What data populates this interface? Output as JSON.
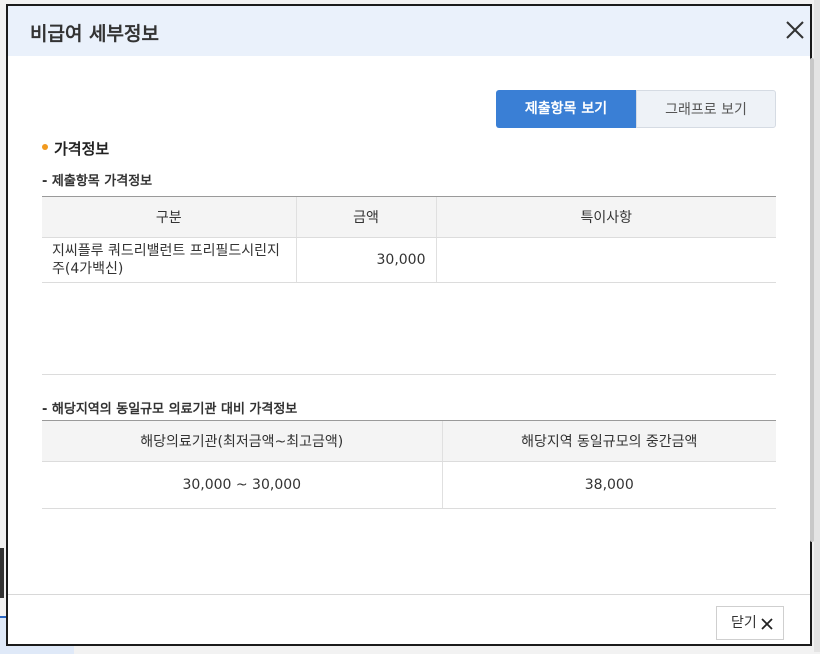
{
  "dialog": {
    "title": "비급여 세부정보",
    "close_icon": "close-icon"
  },
  "tabs": [
    {
      "label": "제출항목 보기",
      "active": true
    },
    {
      "label": "그래프로 보기",
      "active": false
    }
  ],
  "price_info": {
    "section_title": "가격정보",
    "submitted": {
      "title": "- 제출항목 가격정보",
      "columns": [
        "구분",
        "금액",
        "특이사항"
      ],
      "rows": [
        {
          "category": "지씨플루 쿼드리밸런트 프리필드시린지 주(4가백신)",
          "amount": "30,000",
          "note": ""
        }
      ]
    },
    "regional": {
      "title": "- 해당지역의 동일규모 의료기관 대비 가격정보",
      "columns": [
        "해당의료기관(최저금액~최고금액)",
        "해당지역 동일규모의 중간금액"
      ],
      "rows": [
        {
          "range": "30,000 ~ 30,000",
          "median": "38,000"
        }
      ]
    }
  },
  "footer": {
    "close_label": "닫기"
  },
  "colors": {
    "accent": "#3a7fd5",
    "bullet": "#f29a1e",
    "header_bg": "#eaf1fb"
  }
}
